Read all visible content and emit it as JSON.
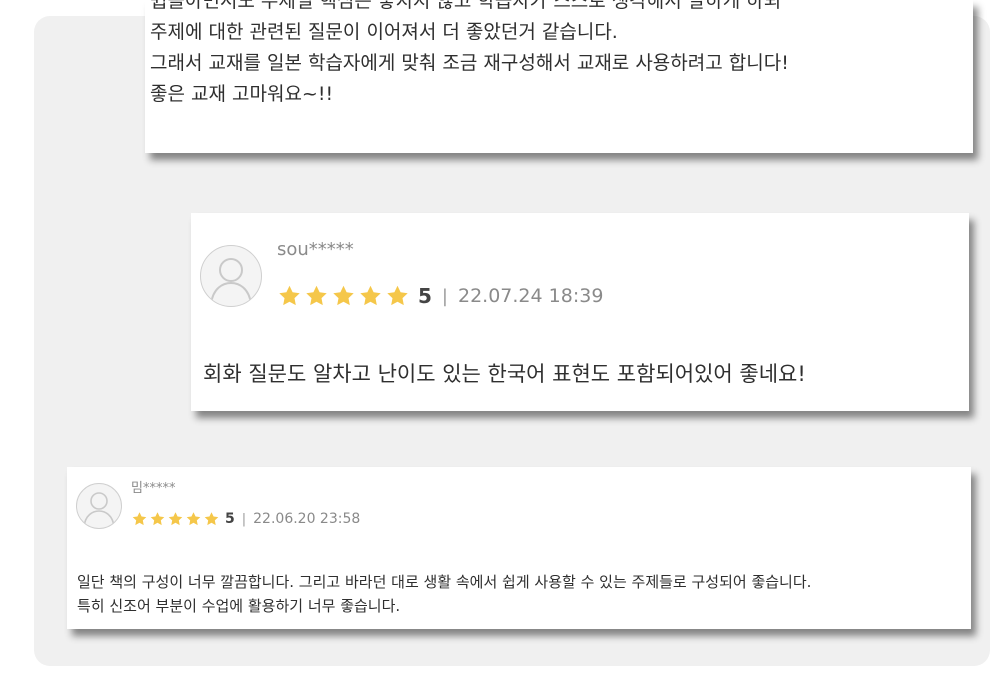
{
  "colors": {
    "star": "#f5c74a",
    "text": "#2f2f2f",
    "muted": "#8a8a8a",
    "panel": "#f0f0f0"
  },
  "reviews": [
    {
      "lines": [
        "쉽을아면서도 주제별 핵심은 놓치지 않고 학습자가 스스로 생각해서 말하게 하되",
        "주제에 대한 관련된 질문이 이어져서 더 좋았던거 같습니다.",
        "그래서 교재를 일본 학습자에게 맞춰 조금 재구성해서 교재로 사용하려고 합니다!",
        "좋은 교재 고마워요~!!"
      ]
    },
    {
      "username": "sou*****",
      "rating": 5,
      "score_label": "5",
      "separator": "|",
      "date": "22.07.24 18:39",
      "avatar_icon": "user-avatar-icon",
      "text": "회화 질문도 알차고 난이도 있는 한국어 표현도 포함되어있어 좋네요!"
    },
    {
      "username": "밈*****",
      "rating": 5,
      "score_label": "5",
      "separator": "|",
      "date": "22.06.20 23:58",
      "avatar_icon": "user-avatar-icon",
      "lines": [
        "일단 책의 구성이 너무 깔끔합니다. 그리고 바라던 대로 생활 속에서 쉽게 사용할 수 있는 주제들로 구성되어 좋습니다.",
        "특히 신조어 부분이 수업에 활용하기 너무 좋습니다."
      ]
    }
  ]
}
